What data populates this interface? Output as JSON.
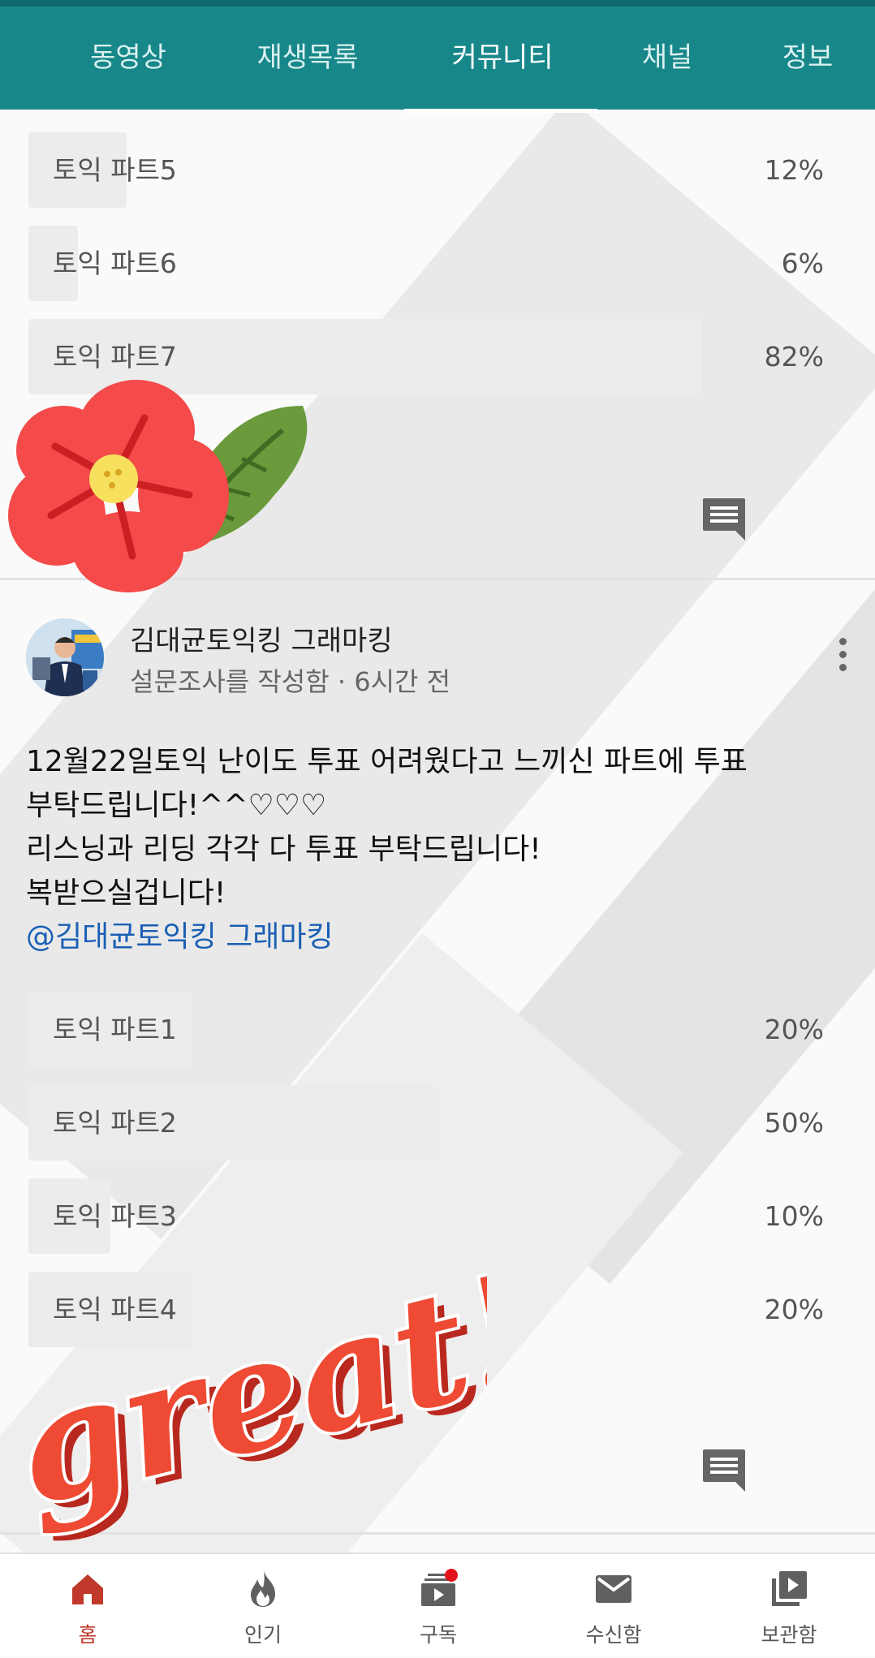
{
  "tabs": [
    {
      "label": "동영상",
      "active": false
    },
    {
      "label": "재생목록",
      "active": false
    },
    {
      "label": "커뮤니티",
      "active": true
    },
    {
      "label": "채널",
      "active": false
    },
    {
      "label": "정보",
      "active": false
    }
  ],
  "poll_previous": [
    {
      "label": "토익 파트5",
      "percent": "12%",
      "value": 0.12
    },
    {
      "label": "토익 파트6",
      "percent": "6%",
      "value": 0.06
    },
    {
      "label": "토익 파트7",
      "percent": "82%",
      "value": 0.82
    }
  ],
  "post": {
    "author": "김대균토익킹 그래마킹",
    "meta": "설문조사를 작성함 · 6시간 전",
    "lines": [
      "12월22일토익 난이도 투표 어려웠다고 느끼신 파트에 투표",
      "부탁드립니다!^^♡♡♡",
      "리스닝과 리딩 각각 다 투표 부탁드립니다!",
      "복받으실겁니다!"
    ],
    "mention": "@김대균토익킹 그래마킹",
    "poll": [
      {
        "label": "토익 파트1",
        "percent": "20%",
        "value": 0.2
      },
      {
        "label": "토익 파트2",
        "percent": "50%",
        "value": 0.5
      },
      {
        "label": "토익 파트3",
        "percent": "10%",
        "value": 0.1
      },
      {
        "label": "토익 파트4",
        "percent": "20%",
        "value": 0.2
      }
    ]
  },
  "bottom_nav": [
    {
      "label": "홈",
      "icon": "home-icon",
      "active": true
    },
    {
      "label": "인기",
      "icon": "fire-icon",
      "active": false
    },
    {
      "label": "구독",
      "icon": "subscriptions-icon",
      "active": false,
      "badge": true
    },
    {
      "label": "수신함",
      "icon": "mail-icon",
      "active": false
    },
    {
      "label": "보관함",
      "icon": "library-icon",
      "active": false
    }
  ],
  "sticker_text": "great!",
  "colors": {
    "header": "#17878a",
    "active_nav": "#c0392b",
    "mention": "#1a5fb4",
    "badge": "#e4131b"
  }
}
